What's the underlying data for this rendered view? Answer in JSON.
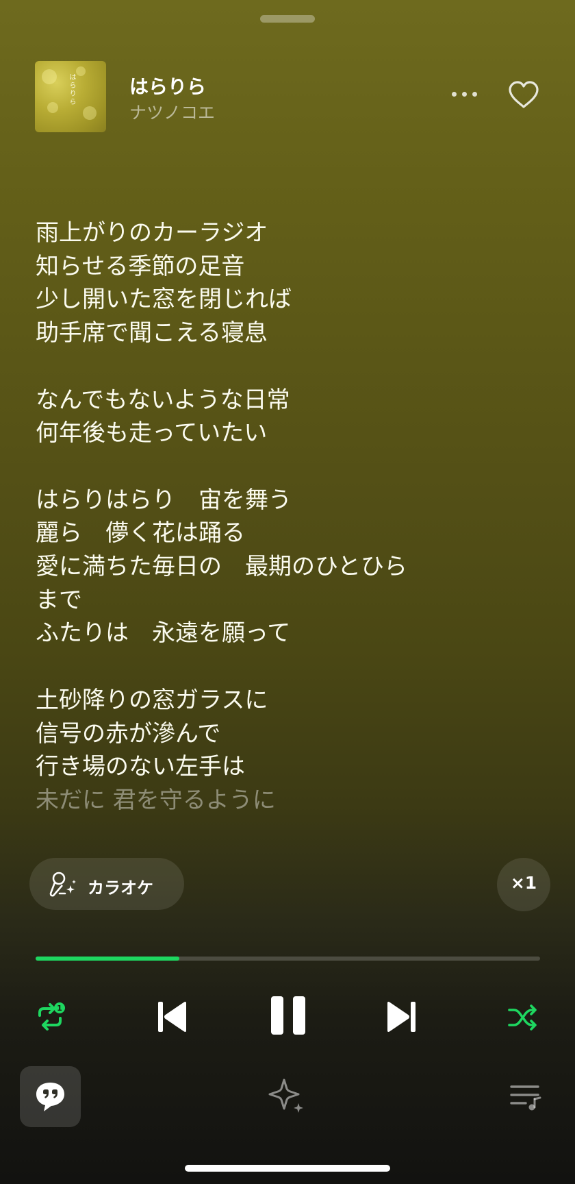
{
  "track": {
    "title": "はらりら",
    "artist": "ナツノコエ",
    "cover_text": "はらりら"
  },
  "lyrics": {
    "lines": [
      "雨上がりのカーラジオ",
      "知らせる季節の足音",
      "少し開いた窓を閉じれば",
      "助手席で聞こえる寝息",
      "",
      "なんでもないような日常",
      "何年後も走っていたい",
      "",
      "はらりはらり　宙を舞う",
      "麗ら　儚く花は踊る",
      "愛に満ちた毎日の　最期のひとひら",
      "まで",
      "ふたりは　永遠を願って",
      "",
      "土砂降りの窓ガラスに",
      "信号の赤が滲んで",
      "行き場のない左手は",
      "未だに 君を守るように"
    ],
    "dim_index": 17
  },
  "karaoke": {
    "label": "カラオケ",
    "icon": "microphone-sparkle-icon"
  },
  "speed": {
    "label": "×1"
  },
  "playback": {
    "progress": 0.285,
    "repeat_badge": "1"
  },
  "icons": {
    "more": "more-icon",
    "like": "heart-icon",
    "repeat": "repeat-one-icon",
    "previous": "skip-previous-icon",
    "pause": "pause-icon",
    "next": "skip-next-icon",
    "shuffle": "shuffle-icon",
    "lyrics": "quote-bubble-icon",
    "sparkle": "sparkle-icon",
    "queue": "queue-icon"
  },
  "colors": {
    "accent": "#1ed760",
    "background_top": "#6e6a1e",
    "background_bottom": "#121210"
  }
}
